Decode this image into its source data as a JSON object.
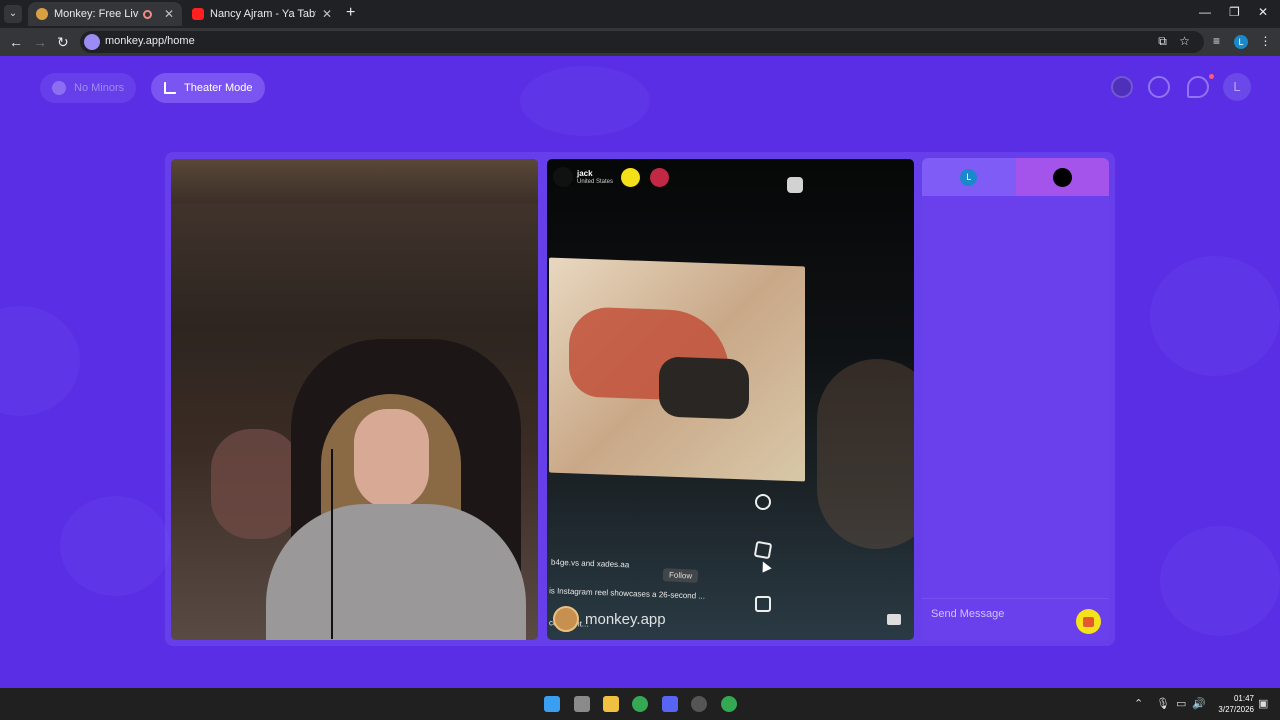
{
  "browser": {
    "tabs": [
      {
        "title": "Monkey: Free Live Video Ch",
        "active": true
      },
      {
        "title": "Nancy Ajram - Ya Tabtab Wa Da",
        "active": false
      }
    ],
    "new_tab": "+",
    "url": "monkey.app/home",
    "profile_initial": "L",
    "window_controls": {
      "minimize": "—",
      "restore": "❐",
      "close": "✕"
    },
    "nav": {
      "back": "←",
      "forward": "→",
      "reload": "↻"
    }
  },
  "header": {
    "no_minors_label": "No Minors",
    "theater_mode_label": "Theater Mode",
    "profile_initial": "L"
  },
  "remote_user": {
    "name": "jack",
    "country": "United States"
  },
  "stream_overlay": {
    "username_line": "b4ge.vs and xades.aa",
    "follow_label": "Follow",
    "caption": "is Instagram reel showcases a 26-second ...",
    "caption2": "comment..."
  },
  "watermark": "monkey.app",
  "chat": {
    "self_initial": "L",
    "input_placeholder": "Send Message"
  },
  "taskbar": {
    "time": "01:47",
    "date": "3/27/2026"
  },
  "colors": {
    "page_bg": "#5a2ee4",
    "chat_bg": "#6a40ec",
    "gift": "#f6e21a"
  }
}
